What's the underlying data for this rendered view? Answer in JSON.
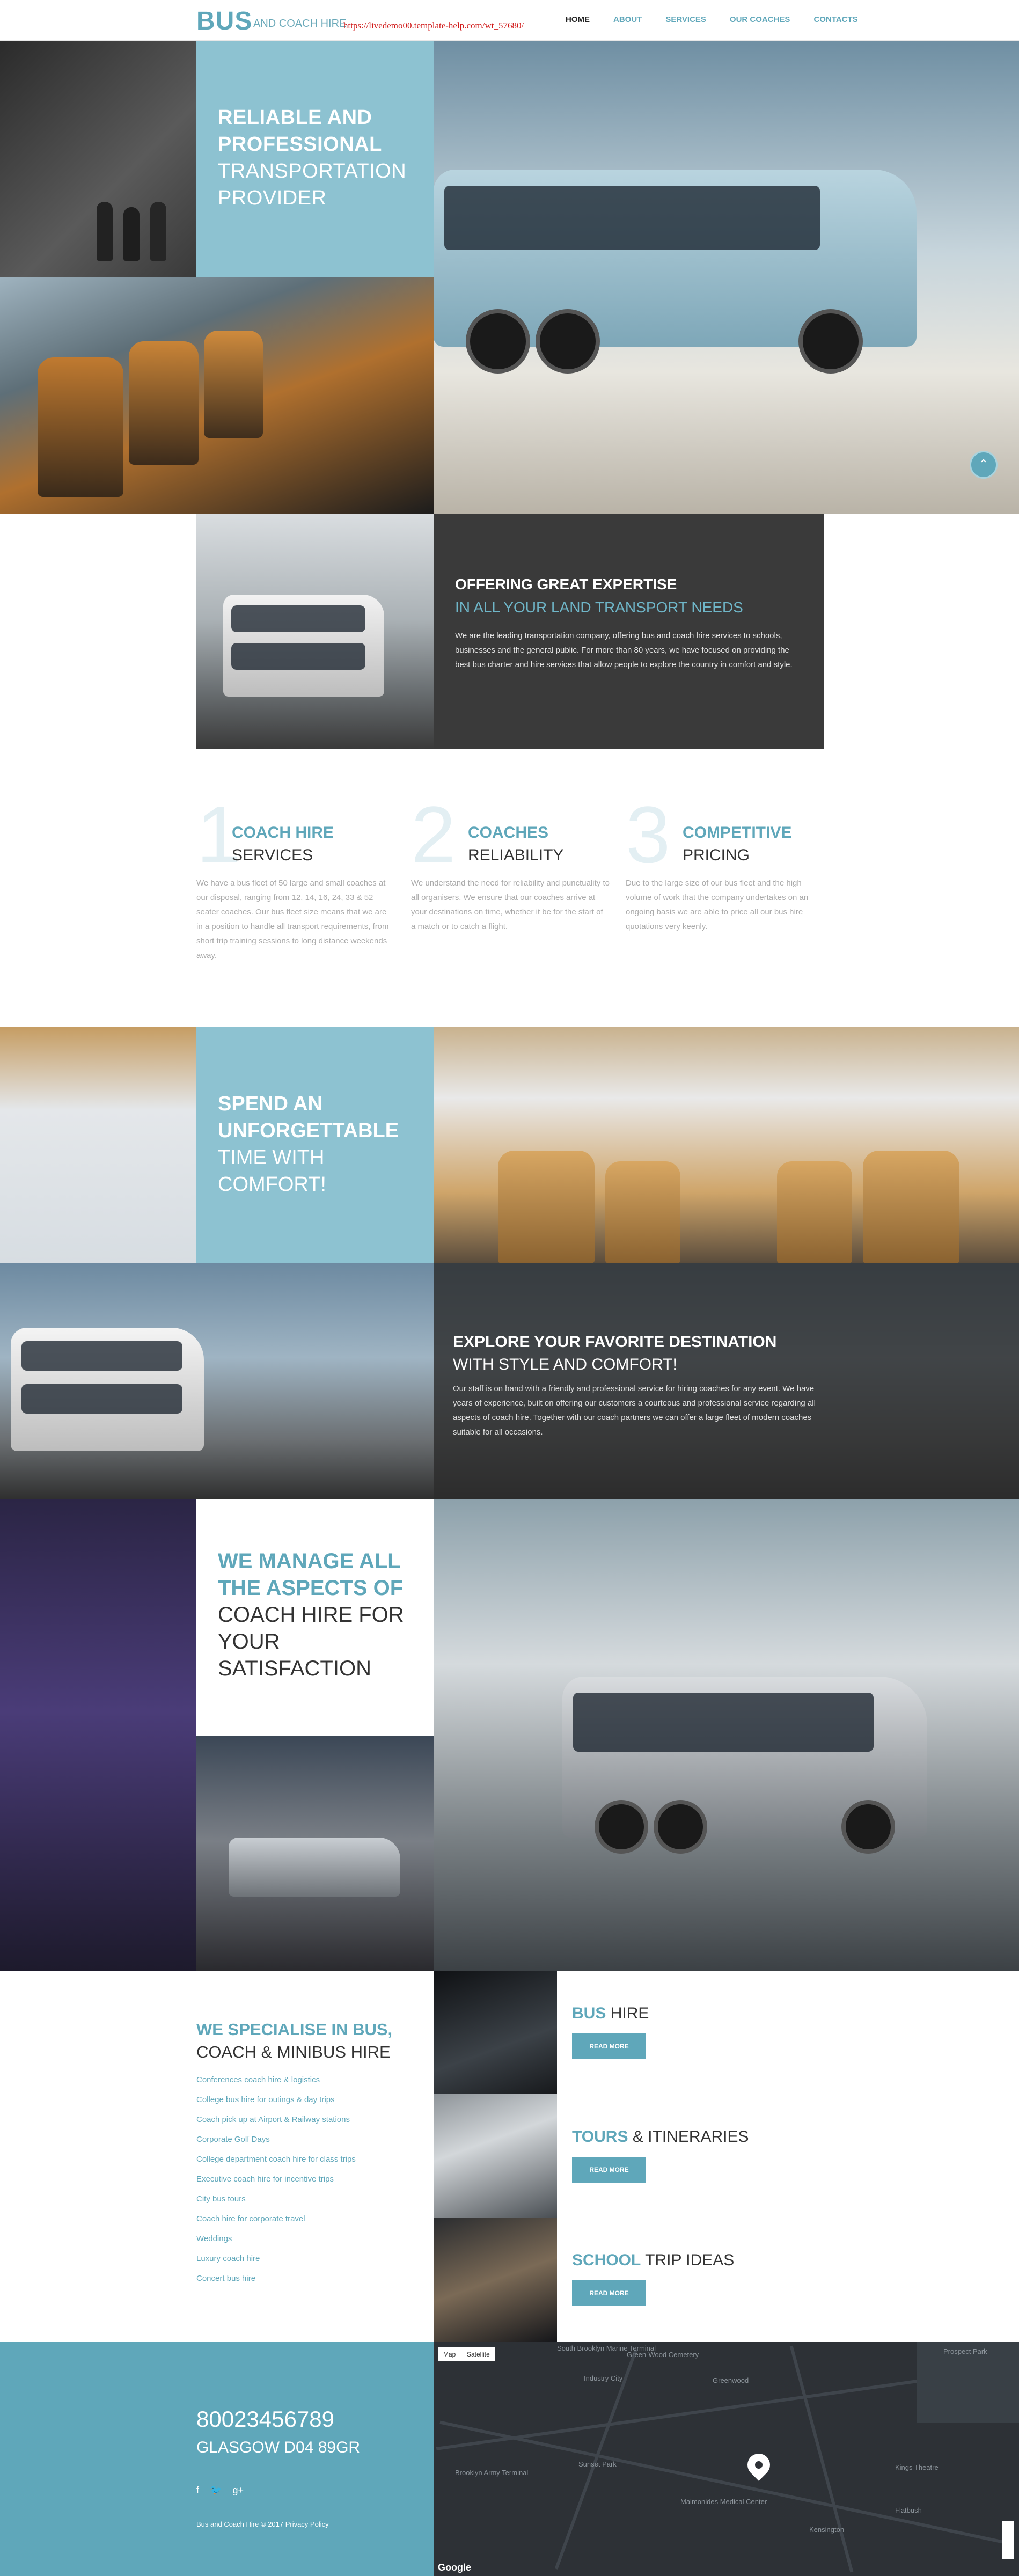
{
  "header": {
    "logo_strong": "BUS",
    "logo_rest": "AND COACH HIRE",
    "url_overlay": "https://livedemo00.template-help.com/wt_57680/",
    "nav": [
      "HOME",
      "ABOUT",
      "SERVICES",
      "OUR COACHES",
      "CONTACTS"
    ],
    "active_nav": "HOME"
  },
  "hero": {
    "title_bold_1": "RELIABLE AND",
    "title_bold_2": "PROFESSIONAL",
    "title_light_1": "TRANSPORTATION",
    "title_light_2": "PROVIDER",
    "scroll_icon": "chevron-up-icon"
  },
  "expertise": {
    "title": "OFFERING GREAT EXPERTISE",
    "subtitle": "IN ALL YOUR LAND TRANSPORT NEEDS",
    "text": "We are the leading transportation company, offering bus and coach hire services to schools, businesses and the general public. For more than 80 years, we have focused on providing the best bus charter and hire services that allow people to explore the country in comfort and style."
  },
  "features": [
    {
      "number": "1",
      "title": "COACH HIRE",
      "subtitle": "SERVICES",
      "text": "We have a bus fleet of 50 large and small coaches at our disposal, ranging from 12, 14, 16, 24, 33 & 52 seater coaches. Our bus fleet size means that we are in a position to handle all transport requirements, from short trip training sessions to long distance weekends away."
    },
    {
      "number": "2",
      "title": "COACHES",
      "subtitle": "RELIABILITY",
      "text": "We understand the need for reliability and punctuality to all organisers. We ensure that our coaches arrive at your destinations on time, whether it be for the start of a match or to catch a flight."
    },
    {
      "number": "3",
      "title": "COMPETITIVE",
      "subtitle": "PRICING",
      "text": "Due to the large size of our bus fleet and the high volume of work that the company undertakes on an ongoing basis we are able to price all our bus hire quotations very keenly."
    }
  ],
  "comfort": {
    "title_bold_1": "SPEND AN",
    "title_bold_2": "UNFORGETTABLE",
    "title_light_1": "TIME WITH",
    "title_light_2": "COMFORT!"
  },
  "destination": {
    "title": "EXPLORE YOUR FAVORITE DESTINATION",
    "subtitle": "WITH STYLE AND COMFORT!",
    "text": "Our staff is on hand with a friendly and professional service for hiring coaches for any event. We have years of experience, built on offering our customers a courteous and professional service regarding all aspects of coach hire. Together with our coach partners we can offer a large fleet of modern coaches suitable for all occasions."
  },
  "manage": {
    "title_bold_1": "WE MANAGE ALL",
    "title_bold_2": "THE ASPECTS OF",
    "title_light_1": "COACH HIRE FOR",
    "title_light_2": "YOUR",
    "title_light_3": "SATISFACTION"
  },
  "specialise": {
    "title_bold": "WE SPECIALISE IN BUS,",
    "title_light": "COACH & MINIBUS HIRE",
    "links": [
      "Conferences coach hire & logistics",
      "College bus hire for outings & day trips",
      "Coach pick up at Airport & Railway stations",
      "Corporate Golf Days",
      "College department coach hire for class trips",
      "Executive coach hire for incentive trips",
      "City bus tours",
      "Coach hire for corporate travel",
      "Weddings",
      "Luxury coach hire",
      "Concert bus hire"
    ]
  },
  "services": [
    {
      "bold": "BUS",
      "light": "HIRE",
      "button": "READ MORE"
    },
    {
      "bold": "TOURS",
      "light": "& ITINERARIES",
      "button": "READ MORE"
    },
    {
      "bold": "SCHOOL",
      "light": "TRIP IDEAS",
      "button": "READ MORE"
    }
  ],
  "footer": {
    "phone": "80023456789",
    "address": "GLASGOW D04 89GR",
    "social_icons": [
      "facebook-icon",
      "twitter-icon",
      "google-plus-icon"
    ],
    "social_glyphs": [
      "f",
      "🐦",
      "g+"
    ],
    "copyright": "Bus and Coach Hire © 2017",
    "privacy": "Privacy Policy"
  },
  "map": {
    "btn_map": "Map",
    "btn_satellite": "Satellite",
    "labels": [
      "South Brooklyn Marine Terminal",
      "Green-Wood Cemetery",
      "Industry City",
      "Prospect Park",
      "Sunset Park",
      "Brooklyn Army Terminal",
      "Kings Theatre",
      "Flatbush",
      "Maimonides Medical Center",
      "Kensington",
      "Greenwood"
    ],
    "attribution": "Google"
  },
  "colors": {
    "accent": "#5fa7ba",
    "dark_panel": "#3a3a3a",
    "text": "#333333"
  }
}
